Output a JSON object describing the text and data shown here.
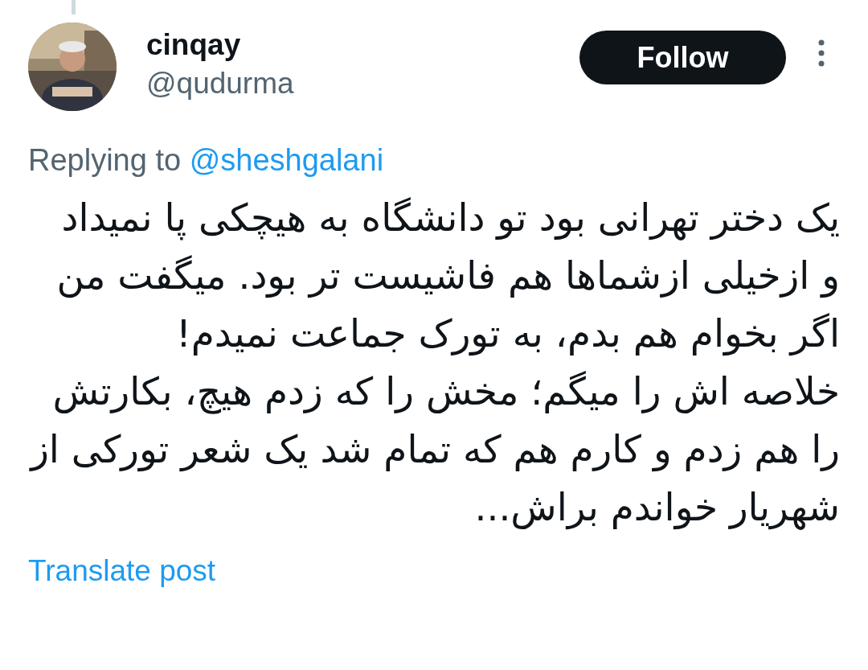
{
  "author": {
    "name": "cinqay",
    "handle": "@qudurma"
  },
  "follow_button": {
    "label": "Follow"
  },
  "reply": {
    "prefix": "Replying to",
    "mention": "@sheshgalani"
  },
  "post": {
    "lines": [
      "یک دختر تهرانی بود تو دانشگاه به هیچکی پا نمیداد",
      "و ازخیلی ازشماها هم فاشیست تر بود. میگفت من",
      "اگر بخوام هم بدم، به تورک جماعت نمیدم!",
      "خلاصه اش را میگم؛ مخش را که زدم هیچ، بکارتش",
      "را هم زدم و کارم هم که تمام شد یک شعر تورکی از",
      "شهریار خواندم براش..."
    ]
  },
  "translate_link": "Translate post"
}
